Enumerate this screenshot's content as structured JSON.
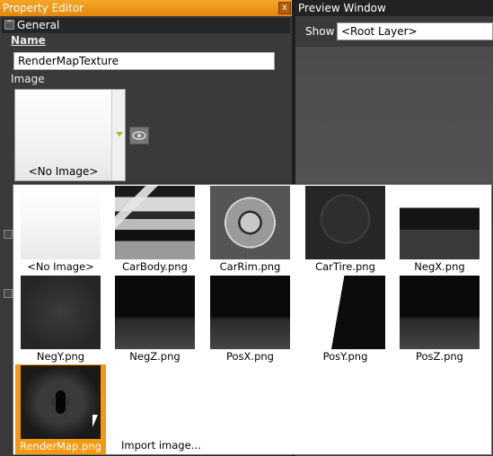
{
  "property_editor": {
    "title": "Property Editor",
    "close_glyph": "x",
    "section_general": "General",
    "toggle_glyph": "^",
    "name_label": "Name",
    "name_value": "RenderMapTexture",
    "image_label": "Image",
    "image_current": "<No Image>"
  },
  "preview_window": {
    "title": "Preview Window",
    "show_label": "Show",
    "show_value": "<Root Layer>"
  },
  "picker": {
    "items": [
      {
        "label": "<No Image>",
        "icon": "blank-thumbnail"
      },
      {
        "label": "CarBody.png",
        "icon": "carbody-thumbnail"
      },
      {
        "label": "CarRim.png",
        "icon": "carrim-thumbnail"
      },
      {
        "label": "CarTire.png",
        "icon": "cartire-thumbnail"
      },
      {
        "label": "NegX.png",
        "icon": "negx-thumbnail"
      },
      {
        "label": "NegY.png",
        "icon": "negy-thumbnail"
      },
      {
        "label": "NegZ.png",
        "icon": "negz-thumbnail"
      },
      {
        "label": "PosX.png",
        "icon": "posx-thumbnail"
      },
      {
        "label": "PosY.png",
        "icon": "posy-thumbnail"
      },
      {
        "label": "PosZ.png",
        "icon": "posz-thumbnail"
      },
      {
        "label": "RenderMap.png",
        "icon": "rendermap-thumbnail",
        "selected": true
      }
    ],
    "import_label": "Import image..."
  },
  "colors": {
    "accent": "#f39a12",
    "title_bar": "#e4870c",
    "panel_bg": "#3a3a3a"
  }
}
